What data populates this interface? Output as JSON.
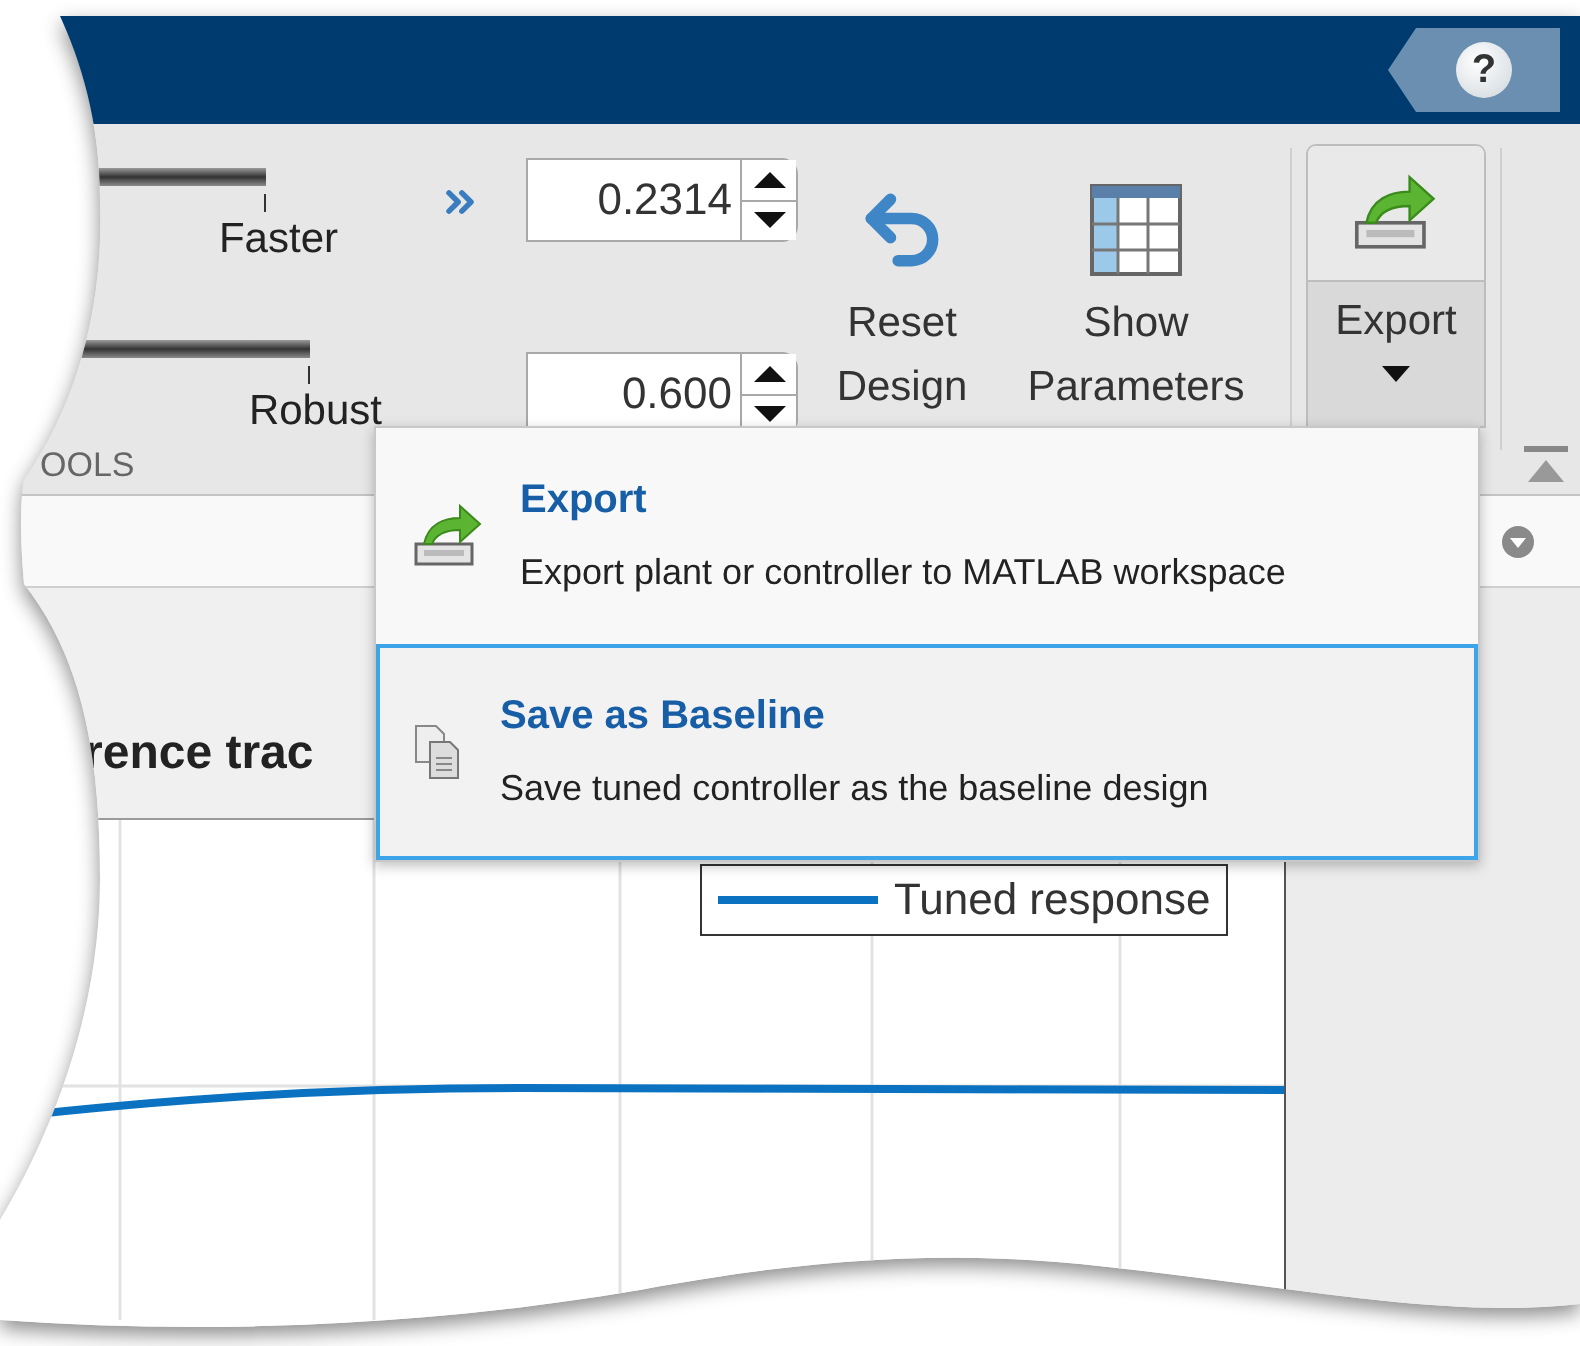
{
  "help_button": {
    "label": "?"
  },
  "toolbar": {
    "sliders": [
      {
        "label": "Faster"
      },
      {
        "label": "Robust"
      }
    ],
    "spinners": [
      {
        "value": "0.2314"
      },
      {
        "value": "0.600"
      }
    ],
    "buttons": [
      {
        "label": "Reset Design",
        "kind": "reset"
      },
      {
        "label": "Show Parameters",
        "kind": "table"
      }
    ],
    "section_label": "OOLS",
    "export_button": {
      "label": "Export",
      "expanded": true
    }
  },
  "menu": {
    "items": [
      {
        "title": "Export",
        "description": "Export plant or controller to MATLAB workspace",
        "kind": "export",
        "selected": false
      },
      {
        "title": "Save as Baseline",
        "description": "Save tuned controller as the baseline design",
        "kind": "copy",
        "selected": true
      }
    ]
  },
  "plot": {
    "title": "rence trac",
    "legend": [
      "Tuned response"
    ]
  }
}
